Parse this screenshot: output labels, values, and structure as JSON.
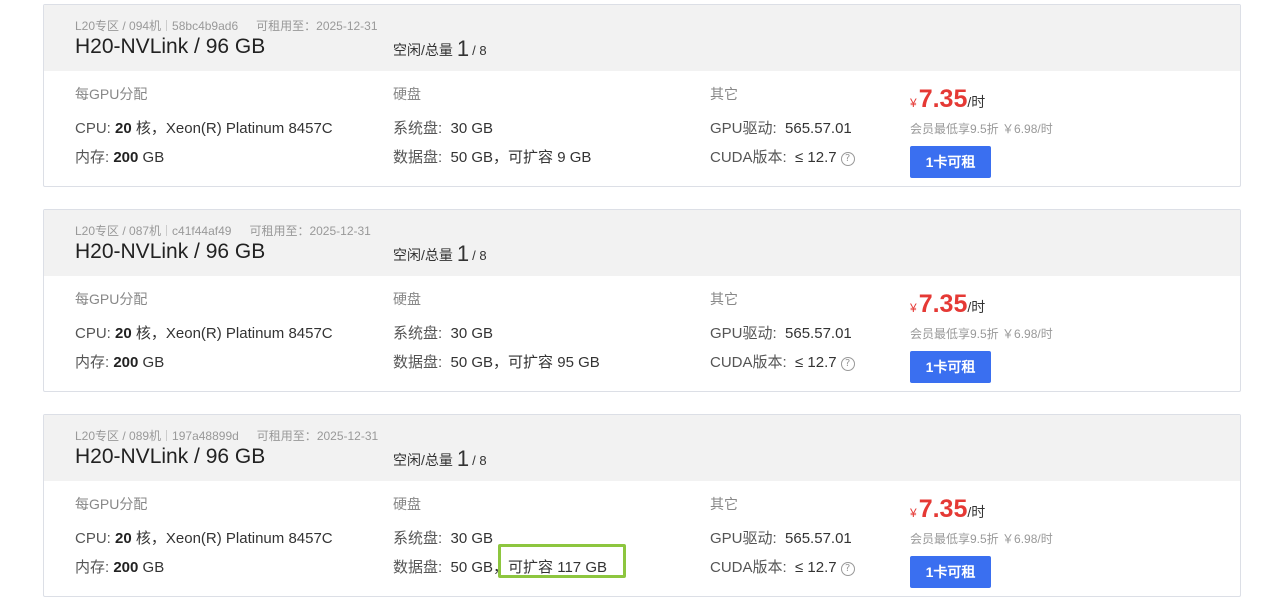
{
  "labels": {
    "avail": "空闲/总量",
    "until": "可租用至：",
    "gpu_alloc": "每GPU分配",
    "disk": "硬盘",
    "other": "其它",
    "cpu": "CPU:",
    "cores_unit": "核，",
    "mem": "内存:",
    "gb": "GB",
    "sys_disk": "系统盘:",
    "data_disk": "数据盘:",
    "expandable": "，可扩容",
    "gpu_driver": "GPU驱动:",
    "cuda": "CUDA版本:",
    "currency": "¥",
    "per_hour": "/时",
    "help_glyph": "?"
  },
  "machines": [
    {
      "zone": "L20专区 / 094机",
      "id": "58bc4b9ad6",
      "until": "2025-12-31",
      "title": "H20-NVLink / 96 GB",
      "free": "1",
      "total": "/ 8",
      "cpu_cores": "20",
      "cpu_model": "Xeon(R) Platinum 8457C",
      "mem": "200",
      "sys_disk": "30 GB",
      "data_disk": "50 GB",
      "expand": "9 GB",
      "driver": "565.57.01",
      "cuda": "≤ 12.7",
      "price": "7.35",
      "member_price": "会员最低享9.5折 ￥6.98/时",
      "button": "1卡可租"
    },
    {
      "zone": "L20专区 / 087机",
      "id": "c41f44af49",
      "until": "2025-12-31",
      "title": "H20-NVLink / 96 GB",
      "free": "1",
      "total": "/ 8",
      "cpu_cores": "20",
      "cpu_model": "Xeon(R) Platinum 8457C",
      "mem": "200",
      "sys_disk": "30 GB",
      "data_disk": "50 GB",
      "expand": "95 GB",
      "driver": "565.57.01",
      "cuda": "≤ 12.7",
      "price": "7.35",
      "member_price": "会员最低享9.5折 ￥6.98/时",
      "button": "1卡可租"
    },
    {
      "zone": "L20专区 / 089机",
      "id": "197a48899d",
      "until": "2025-12-31",
      "title": "H20-NVLink / 96 GB",
      "free": "1",
      "total": "/ 8",
      "cpu_cores": "20",
      "cpu_model": "Xeon(R) Platinum 8457C",
      "mem": "200",
      "sys_disk": "30 GB",
      "data_disk": "50 GB",
      "expand": "117 GB",
      "driver": "565.57.01",
      "cuda": "≤ 12.7",
      "price": "7.35",
      "member_price": "会员最低享9.5折 ￥6.98/时",
      "button": "1卡可租"
    }
  ],
  "colors": {
    "price": "#e53935",
    "button": "#3a6ff0",
    "highlight_box": "#8dc63f",
    "header_bg": "#f2f2f2"
  }
}
